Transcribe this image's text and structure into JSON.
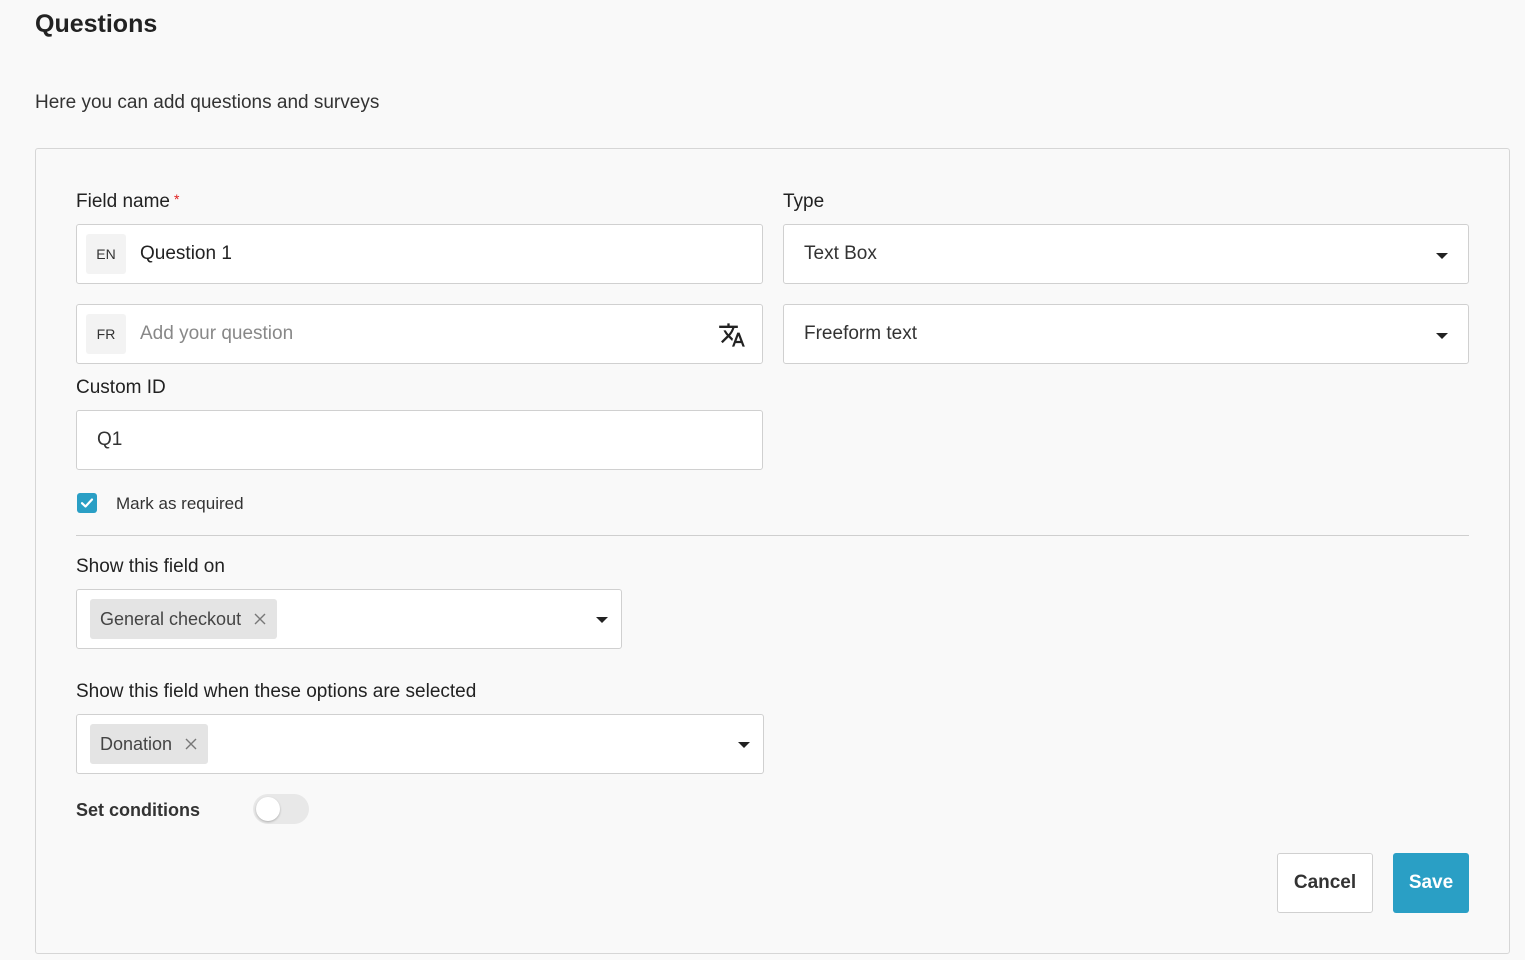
{
  "page": {
    "title": "Questions",
    "subtitle": "Here you can add questions and surveys"
  },
  "form": {
    "field_name_label": "Field name",
    "required_marker": "*",
    "en": {
      "lang": "EN",
      "value": "Question 1"
    },
    "fr": {
      "lang": "FR",
      "placeholder": "Add your question"
    },
    "type_label": "Type",
    "type_value": "Text Box",
    "subtype_value": "Freeform text",
    "custom_id_label": "Custom ID",
    "custom_id_value": "Q1",
    "mark_required_label": "Mark as required",
    "mark_required_checked": true,
    "show_on_label": "Show this field on",
    "show_on_chips": [
      "General checkout"
    ],
    "show_when_label": "Show this field when these options are selected",
    "show_when_chips": [
      "Donation"
    ],
    "set_conditions_label": "Set conditions",
    "set_conditions_enabled": false
  },
  "actions": {
    "cancel_label": "Cancel",
    "save_label": "Save"
  },
  "colors": {
    "accent": "#2a9fc5",
    "required": "#e02020"
  }
}
